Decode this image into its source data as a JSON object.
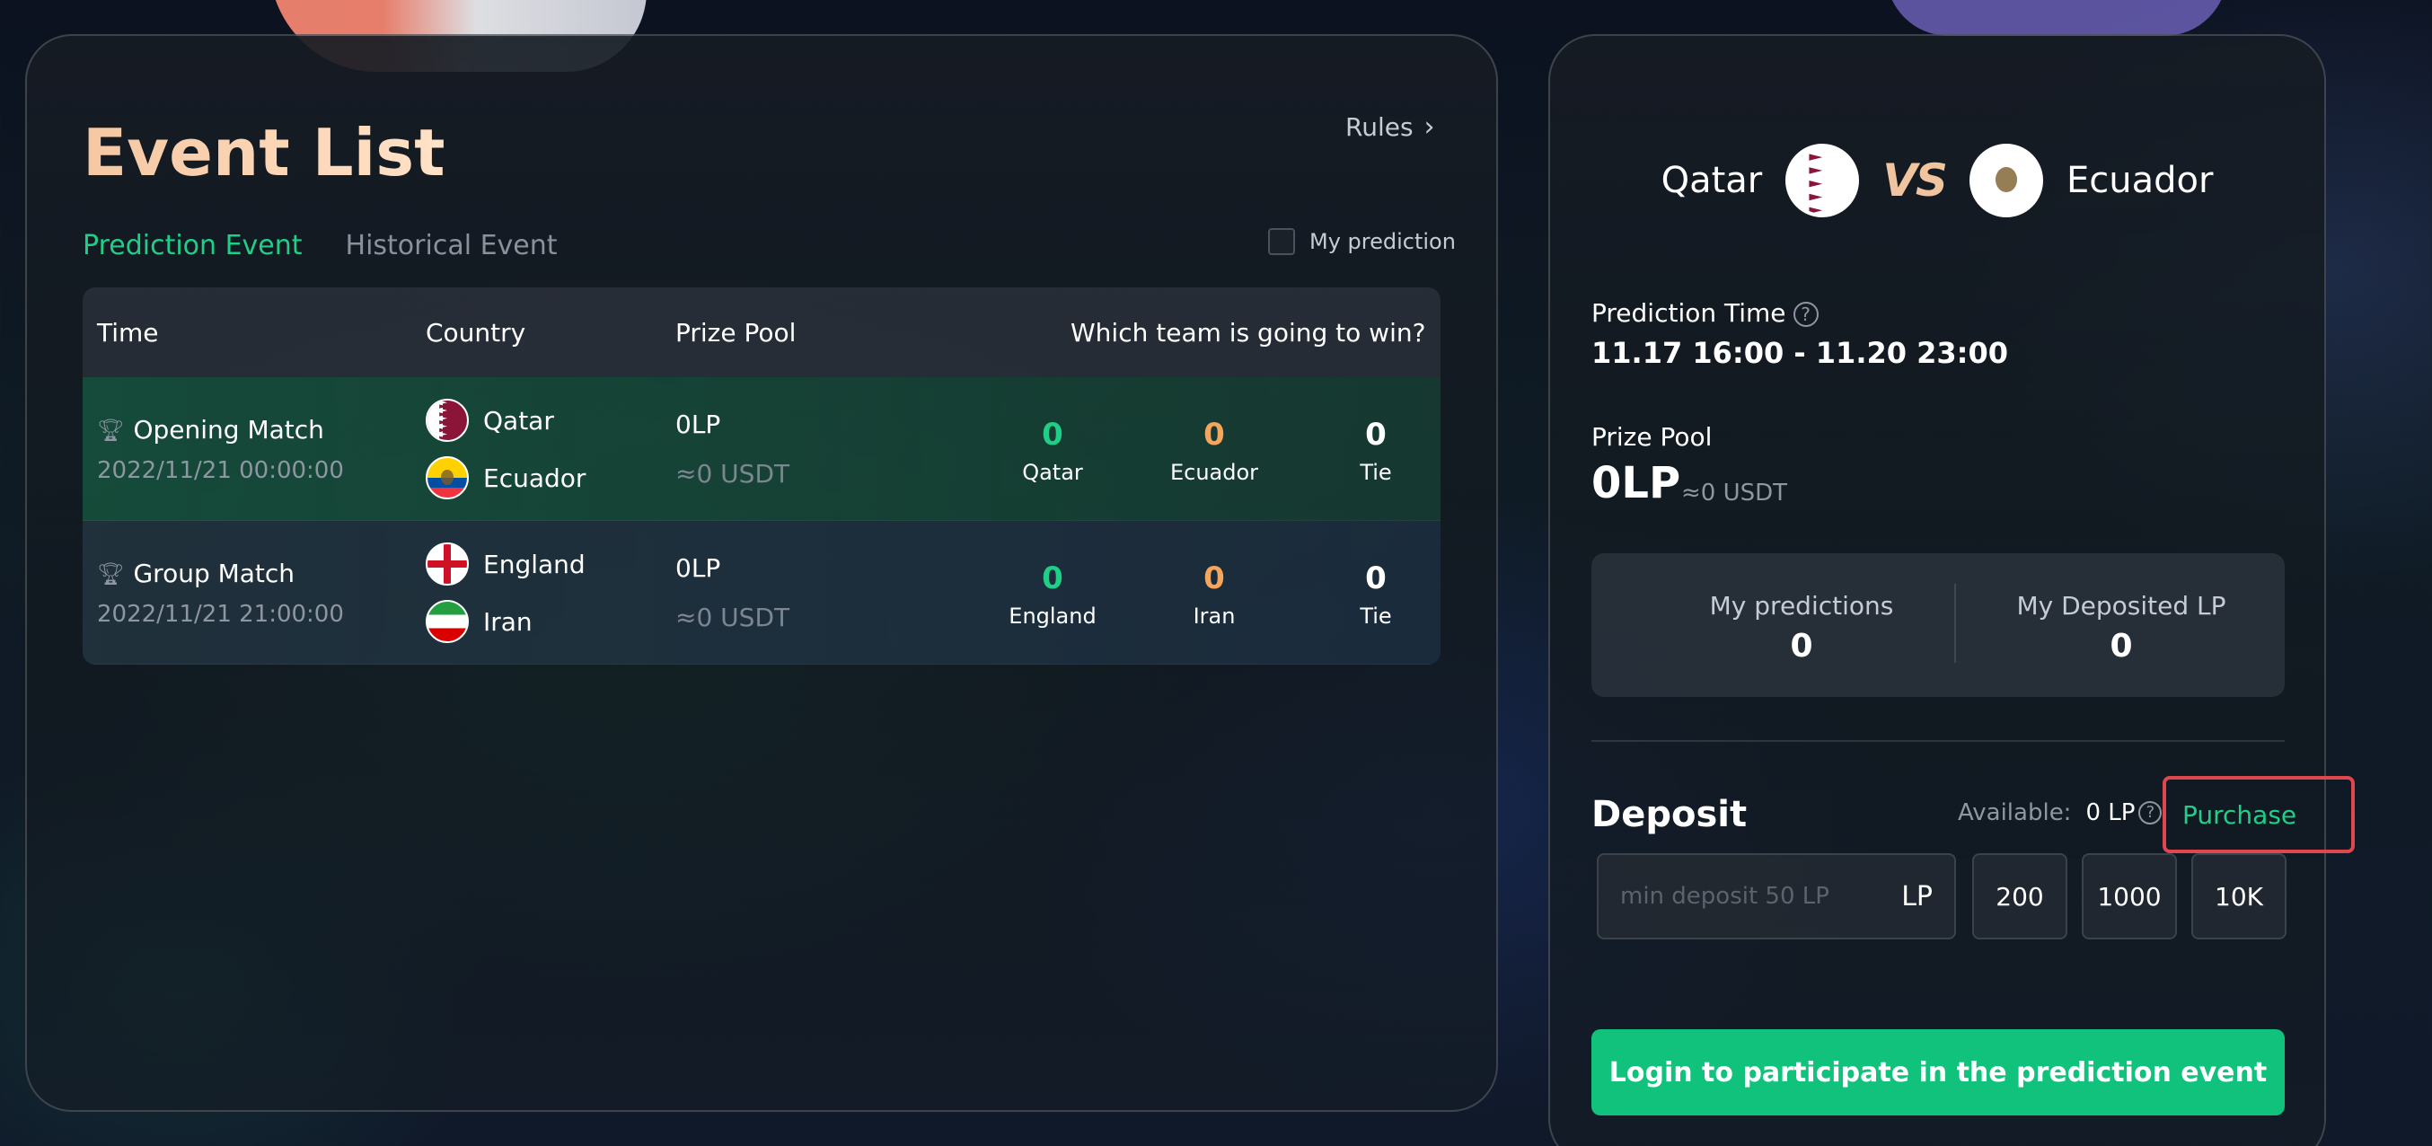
{
  "event_list": {
    "title": "Event List",
    "rules_label": "Rules",
    "tabs": [
      {
        "label": "Prediction Event",
        "active": true
      },
      {
        "label": "Historical Event",
        "active": false
      }
    ],
    "my_prediction_label": "My prediction",
    "columns": {
      "time": "Time",
      "country": "Country",
      "prize_pool": "Prize Pool",
      "which_team": "Which team is going to win?"
    },
    "rows": [
      {
        "match": "Opening Match",
        "date": "2022/11/21 00:00:00",
        "team1": "Qatar",
        "team2": "Ecuador",
        "prize_lp": "0LP",
        "prize_usdt": "≈0 USDT",
        "pred": [
          {
            "value": "0",
            "label": "Qatar"
          },
          {
            "value": "0",
            "label": "Ecuador"
          },
          {
            "value": "0",
            "label": "Tie"
          }
        ]
      },
      {
        "match": "Group Match",
        "date": "2022/11/21 21:00:00",
        "team1": "England",
        "team2": "Iran",
        "prize_lp": "0LP",
        "prize_usdt": "≈0 USDT",
        "pred": [
          {
            "value": "0",
            "label": "England"
          },
          {
            "value": "0",
            "label": "Iran"
          },
          {
            "value": "0",
            "label": "Tie"
          }
        ]
      }
    ]
  },
  "detail": {
    "team1": "Qatar",
    "vs": "VS",
    "team2": "Ecuador",
    "prediction_time_label": "Prediction Time",
    "prediction_time": "11.17 16:00 - 11.20 23:00",
    "prize_pool_label": "Prize Pool",
    "prize_pool_lp": "0LP",
    "prize_pool_usdt": "≈0 USDT",
    "my_predictions_label": "My predictions",
    "my_predictions": "0",
    "my_deposited_label": "My Deposited LP",
    "my_deposited": "0",
    "deposit_title": "Deposit",
    "available_label": "Available:",
    "available_amount": "0 LP",
    "purchase_label": "Purchase",
    "deposit_placeholder": "min deposit 50 LP",
    "deposit_unit": "LP",
    "chips": [
      "200",
      "1000",
      "10K"
    ],
    "login_button": "Login to participate in the prediction event"
  },
  "colors": {
    "accent_green": "#1fcf87",
    "accent_orange": "#f5a55c",
    "highlight_red": "#e0474c"
  }
}
